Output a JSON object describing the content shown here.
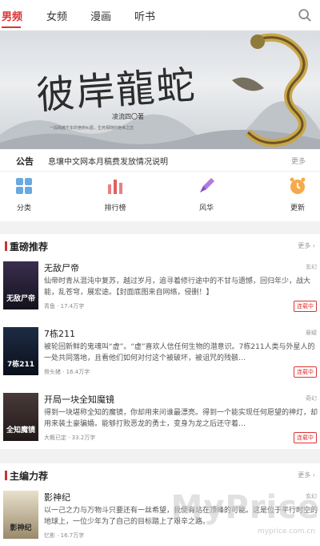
{
  "tabs": [
    {
      "label": "男频",
      "active": true
    },
    {
      "label": "女频",
      "active": false
    },
    {
      "label": "漫画",
      "active": false
    },
    {
      "label": "听书",
      "active": false
    }
  ],
  "banner": {
    "title": "彼岸龍蛇",
    "author": "凌流四〇著",
    "slogan": "一段跨越千年的宿命纠葛，生死相随的绝世之恋"
  },
  "notice": {
    "label": "公告",
    "text": "息壤中文网本月稿费发放情况说明",
    "more": "更多"
  },
  "quick_entries": [
    {
      "label": "分类",
      "icon": "grid-icon",
      "color": "#5b9bd5"
    },
    {
      "label": "排行榜",
      "icon": "bar-chart-icon",
      "color": "#e06060"
    },
    {
      "label": "风华",
      "icon": "pen-icon",
      "color": "#a05ad0"
    },
    {
      "label": "更新",
      "icon": "clock-icon",
      "color": "#f0a030"
    }
  ],
  "sections": [
    {
      "title": "重磅推荐",
      "more": "更多 ›",
      "books": [
        {
          "title": "无敌尸帝",
          "category": "玄幻",
          "cover_text": "无敌尸帝",
          "desc": "仙帝时青从混沌中复苏，越过岁月，追寻着修行途中的不甘与遗憾，回归年少，战大能，乱苍穹，展宏途。【封面底图来自网络，侵删！】",
          "meta": "青鱼 · 17.4万字",
          "status": "连载中"
        },
        {
          "title": "7栋211",
          "category": "悬疑",
          "cover_text": "7栋211",
          "desc": "被轮回新鲜的鬼魂叫“虚”。“虚”喜欢人信任何生物的潜意识。7栋211人类与外星人的一处共同落地，且看他们如何对付这个被破坏，被诅咒的残骸…",
          "meta": "骨头猪 · 16.4万字",
          "status": "连载中"
        },
        {
          "title": "开局一块全知魔镜",
          "category": "奇幻",
          "cover_text": "全知魔镜",
          "desc": "得到一块堪称全知的魔镜，你却用来问谁最漂亮。得到一个能实现任何愿望的神灯，却用来装土豪骗婚。能够打败恶龙的勇士，变身为龙之后还守着…",
          "meta": "大概已定 · 33.2万字",
          "status": "连载中"
        }
      ]
    },
    {
      "title": "主编力荐",
      "more": "更多 ›",
      "books": [
        {
          "title": "影神纪",
          "category": "玄幻",
          "cover_text": "影神纪",
          "desc": "以一己之力与万物斗只要还有一丝希望，我便有站在顶峰的可能。这是位于平行时空的地球上，一位少年为了自己的目标踏上了艰辛之路。",
          "meta": "忆影 · 16.7万字",
          "status": ""
        }
      ]
    }
  ],
  "watermark": {
    "big": "MyPrice",
    "small": "myprice.com.cn"
  }
}
